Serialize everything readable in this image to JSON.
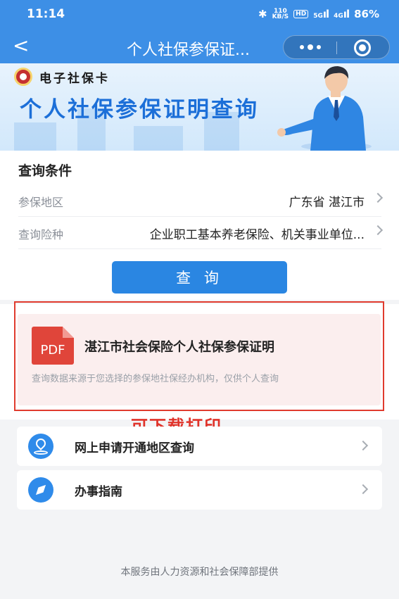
{
  "status_bar": {
    "time": "11:14",
    "net_speed_value": "110",
    "net_speed_unit": "KB/S",
    "hd_label": "HD",
    "signal_1": "5G",
    "signal_2": "4G",
    "battery": "86%"
  },
  "navbar": {
    "back_icon": "chevron-left-icon",
    "title": "个人社保参保证..."
  },
  "banner": {
    "brand": "电子社保卡",
    "title": "个人社保参保证明查询"
  },
  "query": {
    "section_title": "查询条件",
    "rows": [
      {
        "label": "参保地区",
        "value": "广东省 湛江市"
      },
      {
        "label": "查询险种",
        "value": "企业职工基本养老保险、机关事业单位..."
      }
    ],
    "button_label": "查 询"
  },
  "certificate": {
    "icon_label": "PDF",
    "title": "湛江市社会保险个人社保参保证明",
    "description": "查询数据来源于您选择的参保地社保经办机构，仅供个人查询"
  },
  "annotation": "可下载打印",
  "links": [
    {
      "icon": "location-pin-icon",
      "label": "网上申请开通地区查询"
    },
    {
      "icon": "compass-icon",
      "label": "办事指南"
    }
  ],
  "footer": "本服务由人力资源和社会保障部提供",
  "colors": {
    "primary": "#3d8fe6",
    "button": "#2a86e2",
    "highlight_border": "#e03b2e",
    "pdf_red": "#e0453a"
  }
}
